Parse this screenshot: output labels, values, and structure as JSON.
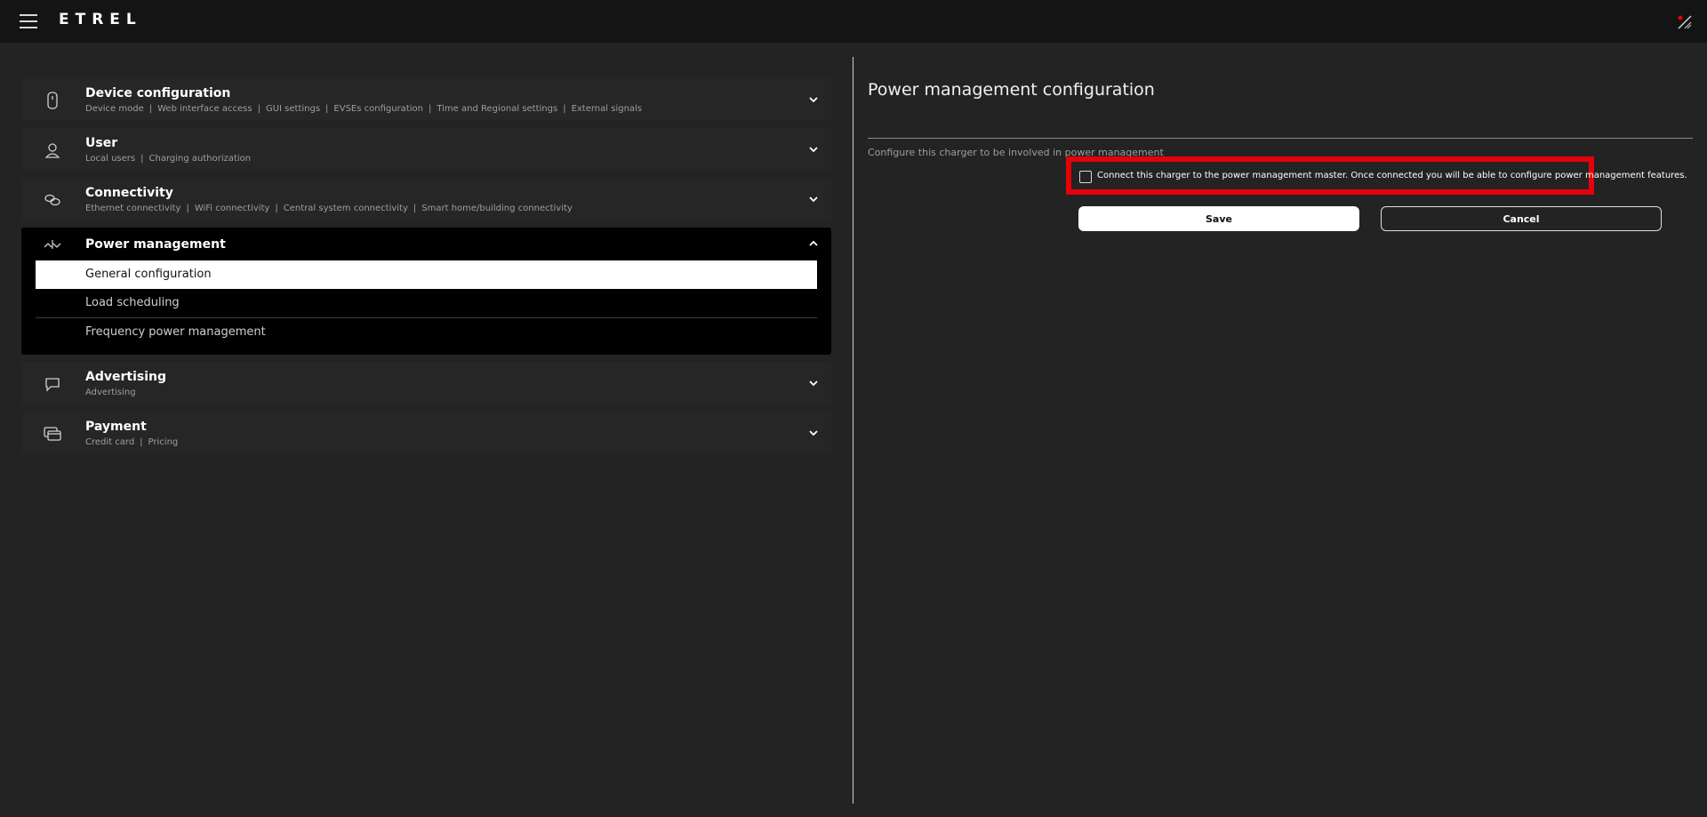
{
  "app": {
    "logo": "ETREL"
  },
  "menu": {
    "sections": [
      {
        "title": "Device configuration",
        "items": [
          "Device mode",
          "Web interface access",
          "GUI settings",
          "EVSEs configuration",
          "Time and Regional settings",
          "External signals"
        ]
      },
      {
        "title": "User",
        "items": [
          "Local users",
          "Charging authorization"
        ]
      },
      {
        "title": "Connectivity",
        "items": [
          "Ethernet connectivity",
          "WiFi connectivity",
          "Central system connectivity",
          "Smart home/building connectivity"
        ]
      },
      {
        "title": "Power management",
        "expanded": true,
        "subitems": [
          "General configuration",
          "Load scheduling",
          "Frequency power management"
        ],
        "active_subitem": "General configuration"
      },
      {
        "title": "Advertising",
        "items": [
          "Advertising"
        ]
      },
      {
        "title": "Payment",
        "items": [
          "Credit card",
          "Pricing"
        ]
      }
    ]
  },
  "panel": {
    "title": "Power management configuration",
    "description": "Configure this charger to be involved in power management",
    "checkbox_label": "Connect this charger to the power management master. Once connected you will be able to configure power management features.",
    "checkbox_checked": false,
    "save_label": "Save",
    "cancel_label": "Cancel"
  },
  "colors": {
    "highlight": "#e5000b",
    "background": "#232323",
    "topbar": "#141414"
  },
  "icons": {
    "menu": "hamburger-icon",
    "connection": "connection-status-icon",
    "device": "device-icon",
    "user": "user-icon",
    "connectivity": "link-icon",
    "power": "power-management-icon",
    "advertising": "chat-bubble-icon",
    "payment": "card-icon"
  }
}
